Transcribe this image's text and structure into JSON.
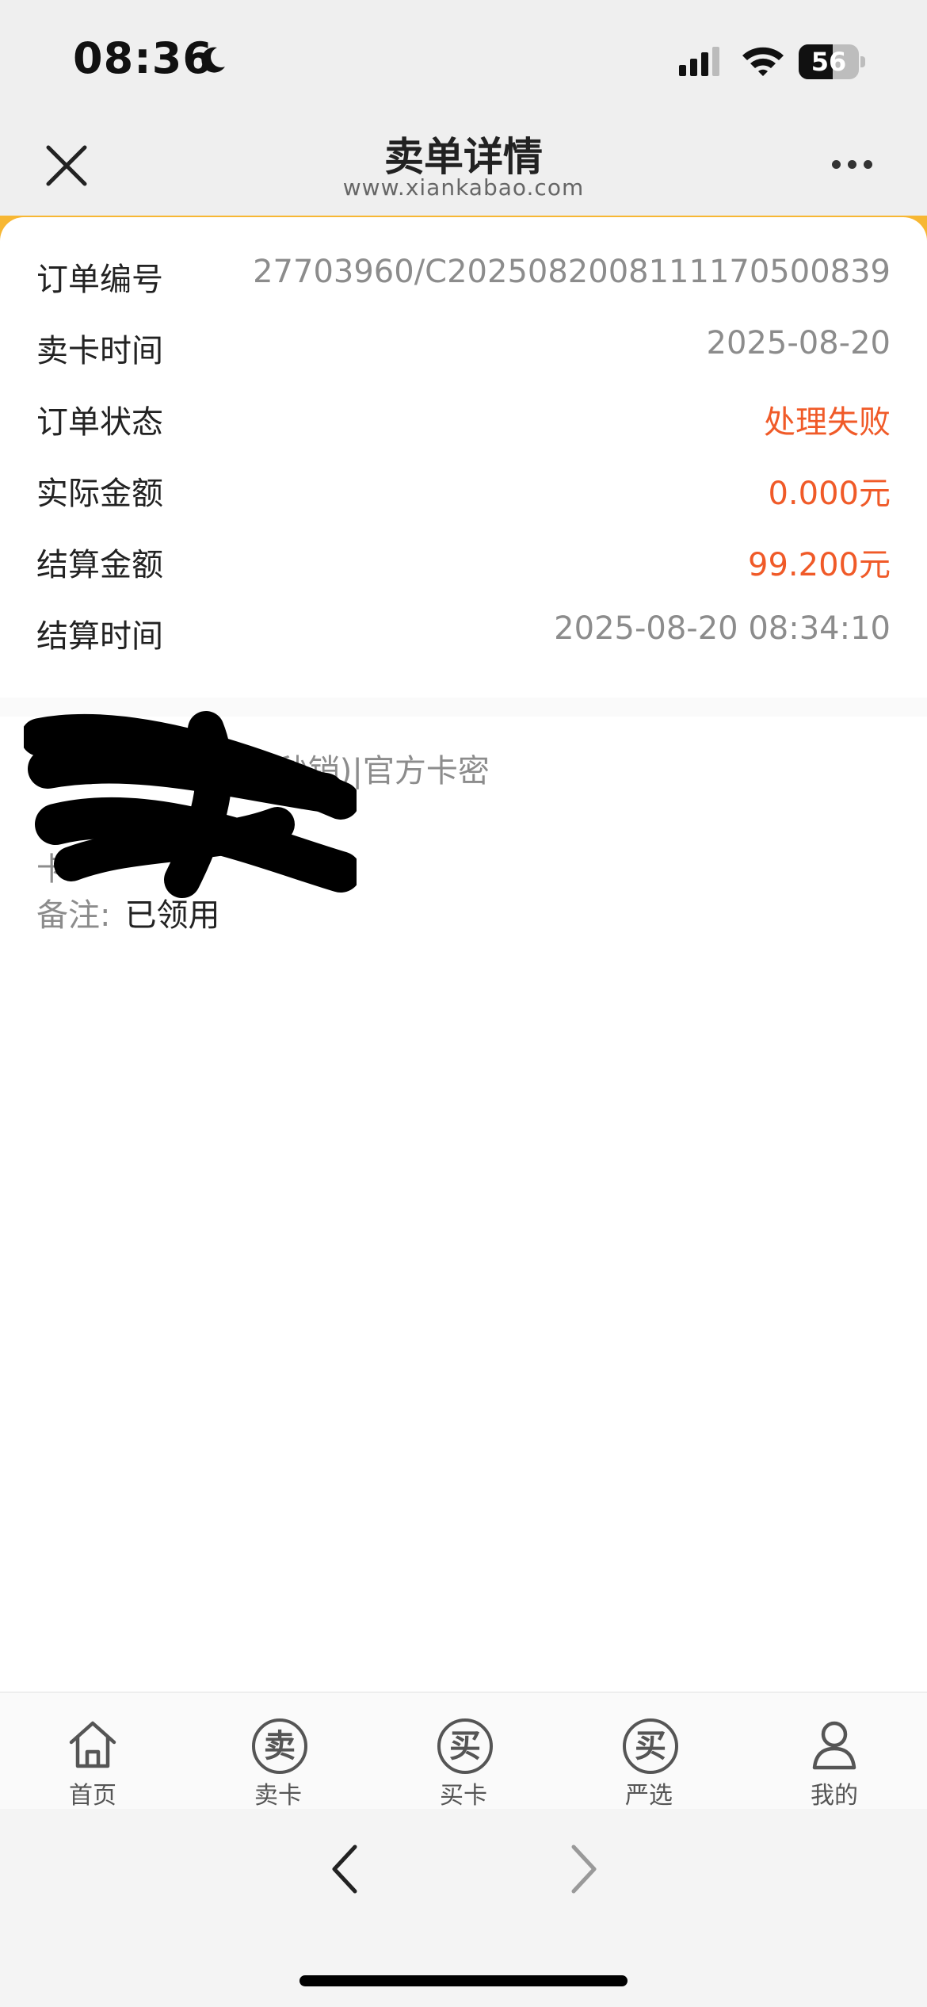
{
  "status_bar": {
    "time": "08:36",
    "battery": "56",
    "battery_level": 0.56,
    "icons": [
      "moon-icon",
      "signal-icon",
      "wifi-icon",
      "battery-icon"
    ]
  },
  "nav": {
    "title": "卖单详情",
    "subtitle": "www.xiankabao.com",
    "close_icon": "close-icon",
    "more_icon": "more-icon"
  },
  "colors": {
    "accent": "#f7b733",
    "highlight": "#f05a28",
    "muted": "#8c8c8c"
  },
  "order": {
    "rows": [
      {
        "label": "订单编号",
        "value": "27703960/C2025082008111170500839",
        "highlight": false
      },
      {
        "label": "卖卡时间",
        "value": "2025-08-20",
        "highlight": false
      },
      {
        "label": "订单状态",
        "value": "处理失败",
        "highlight": true
      },
      {
        "label": "实际金额",
        "value": "0.000元",
        "highlight": true
      },
      {
        "label": "结算金额",
        "value": "99.200元",
        "highlight": true
      },
      {
        "label": "结算时间",
        "value": "2025-08-20 08:34:10",
        "highlight": false
      }
    ]
  },
  "card_info": {
    "product": "我行50-5000元(秒销)|官方卡密",
    "line2": "卡",
    "line3": "卡",
    "note_label": "备注:",
    "note_value": "已领用"
  },
  "tabs": [
    {
      "label": "首页",
      "icon": "home-icon",
      "glyph": ""
    },
    {
      "label": "卖卡",
      "icon": "sell-card-icon",
      "glyph": "卖"
    },
    {
      "label": "买卡",
      "icon": "buy-card-icon",
      "glyph": "买"
    },
    {
      "label": "严选",
      "icon": "selected-icon",
      "glyph": "买"
    },
    {
      "label": "我的",
      "icon": "user-icon",
      "glyph": ""
    }
  ],
  "browser": {
    "back_icon": "chevron-left-icon",
    "forward_icon": "chevron-right-icon"
  }
}
